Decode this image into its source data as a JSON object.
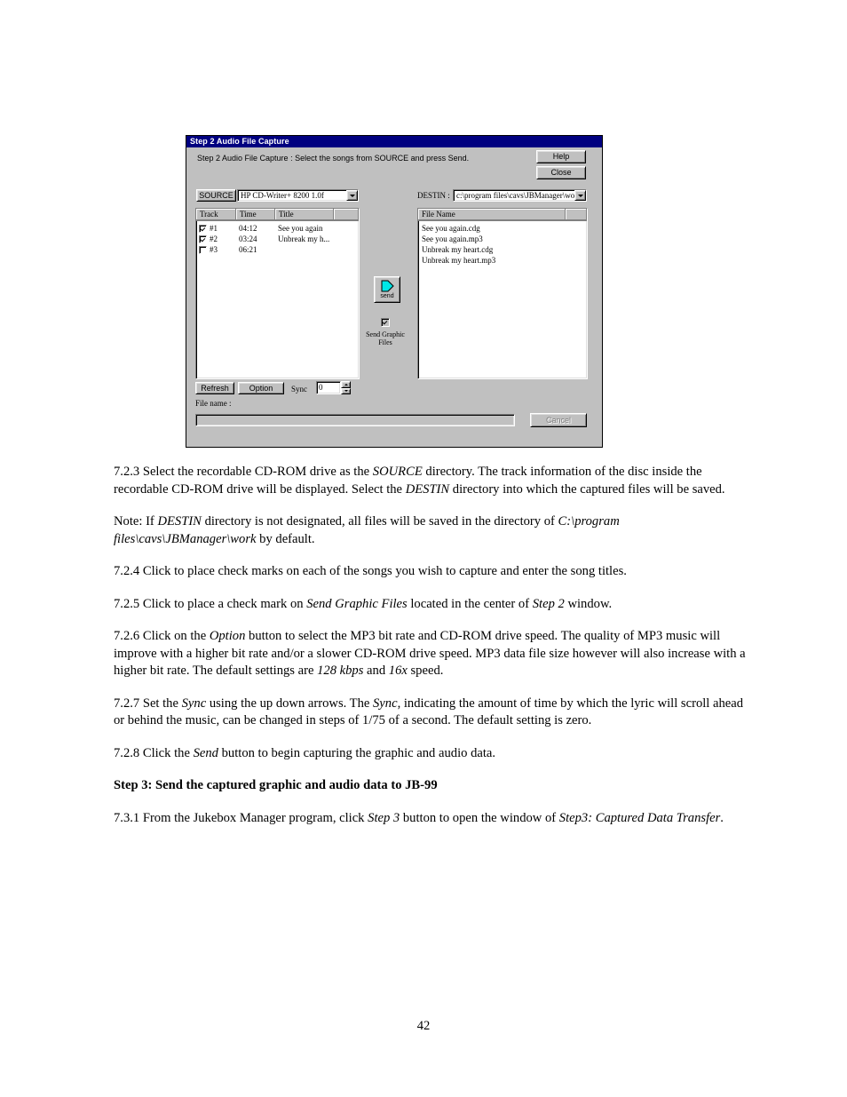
{
  "dialog": {
    "titlebar": "Step 2 Audio File Capture",
    "instruction": "Step 2 Audio File Capture :   Select the songs from SOURCE and press Send.",
    "help_label": "Help",
    "close_label": "Close",
    "source_button_label": "SOURCE",
    "source_combo_value": "HP CD-Writer+ 8200 1.0f",
    "destin_label": "DESTIN :",
    "destin_combo_value": "c:\\program files\\cavs\\JBManager\\wo",
    "track_list": {
      "columns": [
        "Track",
        "Time",
        "Title",
        ""
      ],
      "rows": [
        {
          "checked": true,
          "track": "#1",
          "time": "04:12",
          "title": "See you again"
        },
        {
          "checked": true,
          "track": "#2",
          "time": "03:24",
          "title": "Unbreak my h..."
        },
        {
          "checked": false,
          "track": "#3",
          "time": "06:21",
          "title": ""
        }
      ]
    },
    "file_list": {
      "columns": [
        "File Name",
        ""
      ],
      "rows": [
        "See you again.cdg",
        "See you again.mp3",
        "Unbreak my heart.cdg",
        "Unbreak my heart.mp3"
      ]
    },
    "send_button_label": "send",
    "send_icon": "right-arrow-icon",
    "send_icon_color": "#00d7d7",
    "graphic_checkbox_checked": true,
    "graphic_checkbox_label": "Send Graphic Files",
    "refresh_label": "Refresh",
    "option_label": "Option",
    "sync_label": "Sync",
    "sync_value": "0",
    "filename_label": "File name :",
    "filename_value": "",
    "cancel_label": "Cancel",
    "cancel_disabled": true,
    "titlebar_color": "#000080",
    "face_color": "#c0c0c0"
  },
  "document": {
    "paragraphs": [
      {
        "id": "p-723",
        "html": "7.2.3 Select the recordable CD-ROM drive as the <i>SOURCE</i> directory.    The track information of the disc inside the recordable CD-ROM drive will be displayed.    Select the <i>DESTIN</i> directory into which the captured files will be saved."
      },
      {
        "id": "p-note",
        "html": "Note: If <i>DESTIN</i> directory is not designated, all files will be saved in the directory of <i>C:\\program files\\cavs\\JBManager\\work</i> by default."
      },
      {
        "id": "p-724",
        "html": "7.2.4 Click to place check marks on each of the songs you wish to capture and enter the song titles."
      },
      {
        "id": "p-725",
        "html": "7.2.5 Click to place a check mark on <i>Send Graphic Files</i> located in the center of <i>Step 2</i> window."
      },
      {
        "id": "p-726",
        "html": "7.2.6 Click on the <i>Option</i> button to select the MP3 bit rate and CD-ROM drive speed.    The quality of MP3 music will improve with a higher bit rate and/or a slower CD-ROM drive speed.    MP3 data file size however will also increase with a higher bit rate.    The default settings are <i>128 kbps</i> and <i>16x</i> speed."
      },
      {
        "id": "p-727",
        "html": "7.2.7 Set the <i>Sync</i> using the up down arrows.    The <i>Sync</i>, indicating the amount of time by which the lyric will scroll ahead or behind the music, can be changed in steps of 1/75 of a second.    The default setting is zero."
      },
      {
        "id": "p-728",
        "html": "7.2.8 Click the <i>Send</i> button to begin capturing the graphic and audio data."
      },
      {
        "id": "p-step3",
        "bold": true,
        "html": "Step 3: Send the captured graphic and audio data to JB-99"
      },
      {
        "id": "p-731",
        "html": "7.3.1 From the Jukebox Manager program, click <i>Step 3</i> button to open the window of <i>Step3: Captured Data Transfer</i>."
      }
    ]
  },
  "page_number": "42"
}
